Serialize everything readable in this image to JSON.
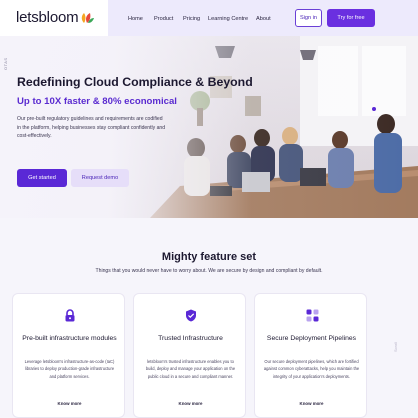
{
  "brand": {
    "name": "letsbloom",
    "accent": "#6a2fe0",
    "logo_colors": [
      "#e8473b",
      "#f5a623",
      "#3aa757"
    ]
  },
  "nav": {
    "items": [
      "Home",
      "Product",
      "Pricing",
      "Learning Centre",
      "About"
    ],
    "signin_label": "Sign in",
    "try_label": "Try for free"
  },
  "hero": {
    "side_tag": "OTAS",
    "title": "Redefining Cloud Compliance & Beyond",
    "subtitle": "Up to 10X faster & 80% economical",
    "description": "Our pre-built regulatory guidelines and requirements are codified in the platform, helping businesses stay compliant confidently and cost-effectively.",
    "primary_cta": "Get started",
    "secondary_cta": "Request demo"
  },
  "features": {
    "title": "Mighty feature set",
    "subtitle": "Things that you would never have to worry about. We are secure by design and compliant by default.",
    "cards": [
      {
        "icon": "lock-icon",
        "title": "Pre-built infrastructure modules",
        "description": "Leverage letsbloom's infrastructure-as-code (IaC) libraries to deploy production-grade infrastructure and platform services.",
        "link": "Know more"
      },
      {
        "icon": "shield-check-icon",
        "title": "Trusted Infrastructure",
        "description": "letsbloom's trusted infrastructure enables you to build, deploy and manage your application on the public cloud in a secure and compliant manner.",
        "link": "Know more"
      },
      {
        "icon": "pipeline-icon",
        "title": "Secure Deployment Pipelines",
        "description": "Our secure deployment pipelines, which are fortified against common cyberattacks, help you maintain the integrity of your application's deployments.",
        "link": "Know more"
      }
    ],
    "scroll_hint": "Scroll"
  }
}
